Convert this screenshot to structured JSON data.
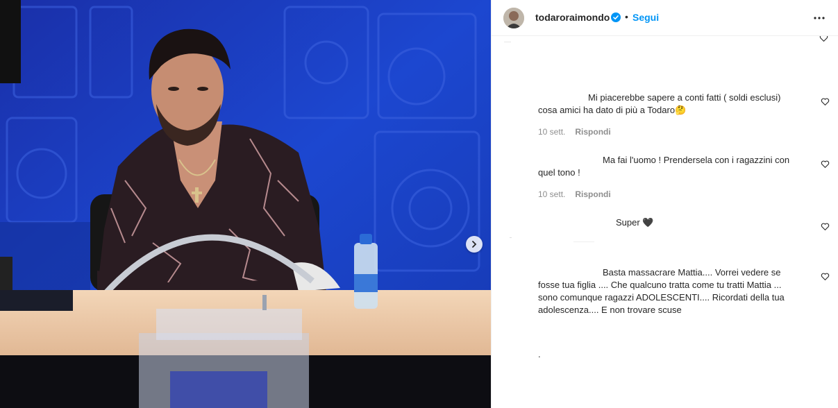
{
  "post": {
    "username": "todaroraimondo",
    "follow_label": "Segui",
    "separator": "•"
  },
  "comments": [
    {
      "text_line1": "Mi piacerebbe sapere a conti fatti ( soldi esclusi)",
      "text_line2": "cosa amici ha dato di più a Todaro",
      "emoji": "🤔",
      "time": "10 sett.",
      "reply_label": "Rispondi"
    },
    {
      "text_line1": "Ma fai l'uomo ! Prendersela con i ragazzini con",
      "text_line2": "quel tono !",
      "time": "10 sett.",
      "reply_label": "Rispondi"
    },
    {
      "text_line1": "Super",
      "emoji": "🖤"
    },
    {
      "text_line1": "Basta massacrare Mattia.... Vorrei vedere se",
      "text_line2": "fosse tua figlia .... Che qualcuno tratta come tu tratti Mattia ...",
      "text_line3": "sono comunque ragazzi ADOLESCENTI.... Ricordati della tua",
      "text_line4": "adolescenza.... E non trovare scuse"
    },
    {
      "text_line1": "."
    }
  ],
  "icons": {
    "like": "heart-icon",
    "next": "chevron-right-icon",
    "more": "more-options-icon",
    "verified": "verified-badge-icon"
  },
  "colors": {
    "link": "#0095f6",
    "verified": "#0095f6",
    "text": "#262626",
    "meta": "#8e8e8e",
    "stage_blue": "#1738b8"
  }
}
